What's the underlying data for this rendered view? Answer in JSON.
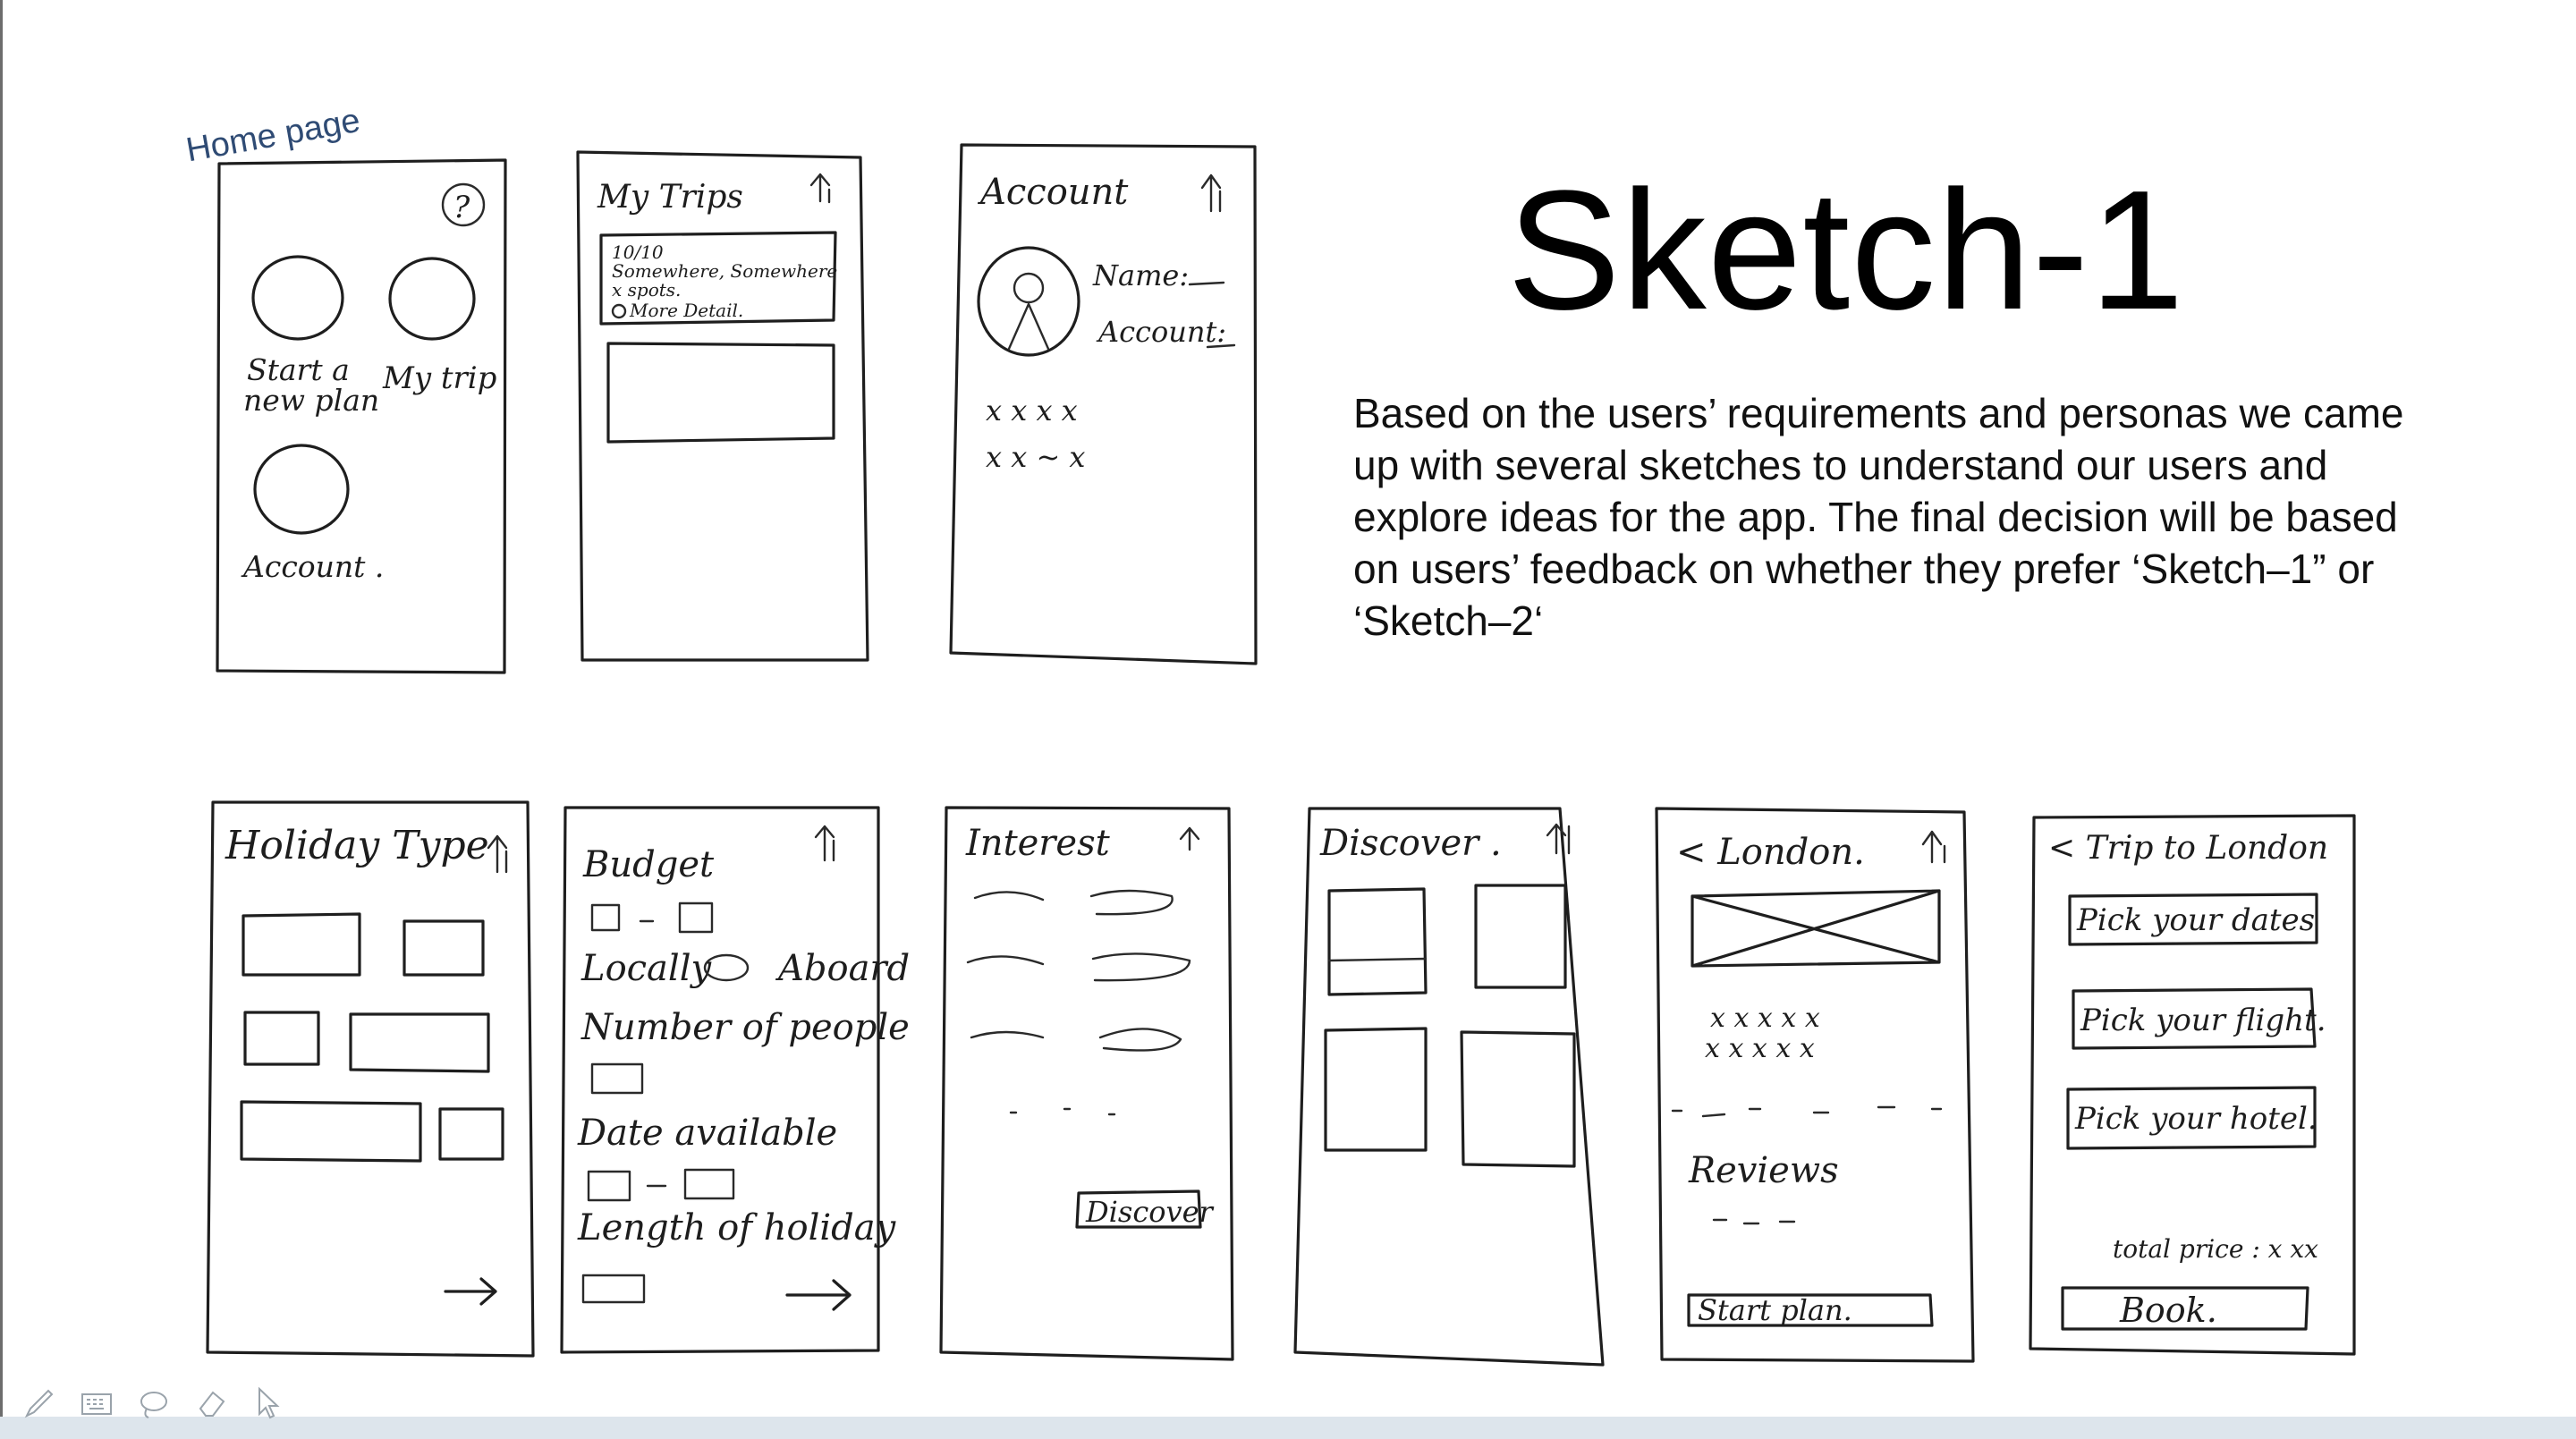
{
  "slide": {
    "title": "Sketch-1",
    "description": "Based on the users’ requirements and personas we came up with several sketches to understand our users and explore ideas for the app. The final decision will be based on users’ feedback on whether they prefer ‘Sketch–1” or ‘Sketch–2‘",
    "home_label": "Home page"
  },
  "sketches": {
    "home": {
      "start_plan": [
        "Start a",
        "new plan"
      ],
      "my_trip": "My trip",
      "account": "Account .",
      "help": "?"
    },
    "my_trips": {
      "title": "My Trips",
      "card_lines": [
        "10/10",
        "Somewhere, Somewhere",
        "x spots.",
        "More Detail."
      ]
    },
    "account": {
      "title": "Account",
      "name": "Name:",
      "account": "Account:",
      "rows": [
        "x x x x",
        "x x ~ x"
      ]
    },
    "holiday_type": {
      "title": "Holiday Type"
    },
    "budget": {
      "title": "Budget",
      "locally": "Locally",
      "aboard": "Aboard",
      "people": "Number of people",
      "date": "Date available",
      "length": "Length of holiday"
    },
    "interest": {
      "title": "Interest",
      "button": "Discover"
    },
    "discover": {
      "title": "Discover ."
    },
    "london": {
      "title": "< London.",
      "reviews": "Reviews",
      "rating_rows": [
        "x x x x x",
        "x x x x x"
      ],
      "button": "Start plan."
    },
    "trip": {
      "title": "< Trip to London",
      "dates": "Pick your dates",
      "flight": "Pick your flight.",
      "hotel": "Pick your hotel.",
      "total": "total price : x xx",
      "book": "Book."
    }
  },
  "toolbar": [
    "pen-tool",
    "keyboard-tool",
    "lasso-tool",
    "eraser-tool",
    "pointer-tool"
  ]
}
